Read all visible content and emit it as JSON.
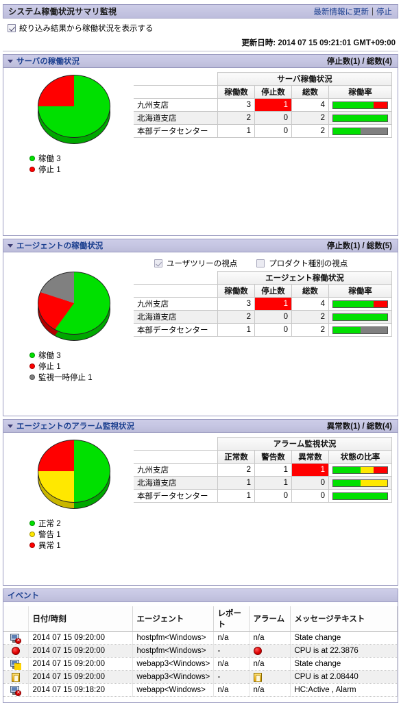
{
  "header": {
    "title": "システム稼働状況サマリ監視",
    "refresh_link": "最新情報に更新",
    "separator": "|",
    "stop_link": "停止",
    "filter_checkbox_label": "絞り込み結果から稼働状況を表示する",
    "updated_at": "更新日時: 2014 07 15 09:21:01 GMT+09:00"
  },
  "colors": {
    "green": "#00e000",
    "red": "#ff0000",
    "yellow": "#ffe800",
    "gray": "#808080",
    "accent": "#1b3f8f"
  },
  "panels": [
    {
      "title": "サーバの稼働状況",
      "count": "停止数(1) / 総数(4)",
      "table_group_header": "サーバ稼働状況",
      "columns": [
        "稼働数",
        "停止数",
        "総数",
        "稼働率"
      ],
      "rows": [
        {
          "name": "九州支店",
          "running": "3",
          "stopped": "1",
          "total": "4",
          "bar": [
            75,
            25,
            0
          ]
        },
        {
          "name": "北海道支店",
          "running": "2",
          "stopped": "0",
          "total": "2",
          "bar": [
            100,
            0,
            0
          ]
        },
        {
          "name": "本部データセンター",
          "running": "1",
          "stopped": "0",
          "total": "2",
          "bar": [
            50,
            0,
            50
          ]
        }
      ],
      "legend": [
        {
          "color": "#00e000",
          "label": "稼働 3"
        },
        {
          "color": "#ff0000",
          "label": "停止 1"
        }
      ]
    },
    {
      "title": "エージェントの稼働状況",
      "count": "停止数(1) / 総数(5)",
      "view_options": [
        {
          "label": "ユーザツリーの視点",
          "checked": true
        },
        {
          "label": "プロダクト種別の視点",
          "checked": false
        }
      ],
      "table_group_header": "エージェント稼働状況",
      "columns": [
        "稼働数",
        "停止数",
        "総数",
        "稼働率"
      ],
      "rows": [
        {
          "name": "九州支店",
          "running": "3",
          "stopped": "1",
          "total": "4",
          "bar": [
            75,
            25,
            0
          ]
        },
        {
          "name": "北海道支店",
          "running": "2",
          "stopped": "0",
          "total": "2",
          "bar": [
            100,
            0,
            0
          ]
        },
        {
          "name": "本部データセンター",
          "running": "1",
          "stopped": "0",
          "total": "2",
          "bar": [
            50,
            0,
            50
          ]
        }
      ],
      "legend": [
        {
          "color": "#00e000",
          "label": "稼働 3"
        },
        {
          "color": "#ff0000",
          "label": "停止 1"
        },
        {
          "color": "#808080",
          "label": "監視一時停止 1"
        }
      ]
    },
    {
      "title": "エージェントのアラーム監視状況",
      "count": "異常数(1) / 総数(4)",
      "table_group_header": "アラーム監視状況",
      "columns": [
        "正常数",
        "警告数",
        "異常数",
        "状態の比率"
      ],
      "rows": [
        {
          "name": "九州支店",
          "running": "2",
          "stopped": "1",
          "total": "1",
          "bar": [
            50,
            25,
            25
          ]
        },
        {
          "name": "北海道支店",
          "running": "1",
          "stopped": "1",
          "total": "0",
          "bar": [
            50,
            50,
            0
          ]
        },
        {
          "name": "本部データセンター",
          "running": "1",
          "stopped": "0",
          "total": "0",
          "bar": [
            100,
            0,
            0
          ]
        }
      ],
      "legend": [
        {
          "color": "#00e000",
          "label": "正常 2"
        },
        {
          "color": "#ffe800",
          "label": "警告 1"
        },
        {
          "color": "#ff0000",
          "label": "異常 1"
        }
      ]
    }
  ],
  "chart_data": [
    {
      "type": "pie",
      "title": "サーバの稼働状況",
      "labels": [
        "稼働",
        "停止"
      ],
      "values": [
        3,
        1
      ],
      "colors": [
        "#00e000",
        "#ff0000"
      ],
      "legend_position": "bottom-left"
    },
    {
      "type": "pie",
      "title": "エージェントの稼働状況",
      "labels": [
        "稼働",
        "停止",
        "監視一時停止"
      ],
      "values": [
        3,
        1,
        1
      ],
      "colors": [
        "#00e000",
        "#ff0000",
        "#808080"
      ],
      "legend_position": "bottom-left"
    },
    {
      "type": "pie",
      "title": "エージェントのアラーム監視状況",
      "labels": [
        "正常",
        "警告",
        "異常"
      ],
      "values": [
        2,
        1,
        1
      ],
      "colors": [
        "#00e000",
        "#ffe800",
        "#ff0000"
      ],
      "legend_position": "bottom-left"
    },
    {
      "type": "bar",
      "title": "サーバ稼働率",
      "categories": [
        "九州支店",
        "北海道支店",
        "本部データセンター"
      ],
      "series": [
        {
          "name": "稼働",
          "values": [
            75,
            100,
            50
          ]
        },
        {
          "name": "停止",
          "values": [
            25,
            0,
            0
          ]
        },
        {
          "name": "監視一時停止",
          "values": [
            0,
            0,
            50
          ]
        }
      ],
      "ylabel": "%",
      "ylim": [
        0,
        100
      ]
    },
    {
      "type": "bar",
      "title": "エージェント稼働率",
      "categories": [
        "九州支店",
        "北海道支店",
        "本部データセンター"
      ],
      "series": [
        {
          "name": "稼働",
          "values": [
            75,
            100,
            50
          ]
        },
        {
          "name": "停止",
          "values": [
            25,
            0,
            0
          ]
        },
        {
          "name": "監視一時停止",
          "values": [
            0,
            0,
            50
          ]
        }
      ],
      "ylabel": "%",
      "ylim": [
        0,
        100
      ]
    },
    {
      "type": "bar",
      "title": "状態の比率",
      "categories": [
        "九州支店",
        "北海道支店",
        "本部データセンター"
      ],
      "series": [
        {
          "name": "正常",
          "values": [
            50,
            50,
            100
          ]
        },
        {
          "name": "警告",
          "values": [
            25,
            50,
            0
          ]
        },
        {
          "name": "異常",
          "values": [
            25,
            0,
            0
          ]
        }
      ],
      "ylabel": "%",
      "ylim": [
        0,
        100
      ]
    }
  ],
  "events": {
    "title": "イベント",
    "columns": [
      "",
      "日付/時刻",
      "エージェント",
      "レポート",
      "アラーム",
      "メッセージテキスト"
    ],
    "rows": [
      {
        "icon": "monitor-error-icon",
        "date": "2014 07 15 09:20:00",
        "agent": "hostpfm<Windows>",
        "report": "n/a",
        "alarm": "n/a",
        "alarm_icon": "",
        "message": "State change"
      },
      {
        "icon": "alarm-critical-icon",
        "date": "2014 07 15 09:20:00",
        "agent": "hostpfm<Windows>",
        "report": "-",
        "alarm": "",
        "alarm_icon": "alarm-critical-icon",
        "message": "CPU is at 22.3876"
      },
      {
        "icon": "monitor-warning-icon",
        "date": "2014 07 15 09:20:00",
        "agent": "webapp3<Windows>",
        "report": "n/a",
        "alarm": "n/a",
        "alarm_icon": "",
        "message": "State change"
      },
      {
        "icon": "alarm-warning-icon",
        "date": "2014 07 15 09:20:00",
        "agent": "webapp3<Windows>",
        "report": "-",
        "alarm": "",
        "alarm_icon": "alarm-warning-icon",
        "message": "CPU is at 2.08440"
      },
      {
        "icon": "monitor-error-icon",
        "date": "2014 07 15 09:18:20",
        "agent": "webapp<Windows>",
        "report": "n/a",
        "alarm": "n/a",
        "alarm_icon": "",
        "message": "HC:Active , Alarm"
      }
    ]
  }
}
